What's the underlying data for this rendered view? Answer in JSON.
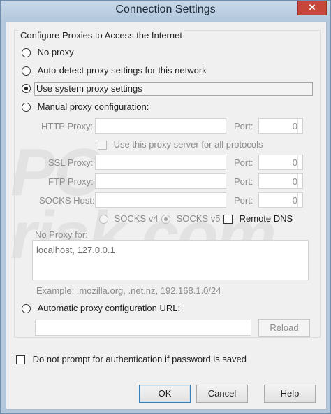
{
  "window": {
    "title": "Connection Settings",
    "close_label": "✕"
  },
  "group_label": "Configure Proxies to Access the Internet",
  "options": {
    "no_proxy": "No proxy",
    "auto_detect": "Auto-detect proxy settings for this network",
    "use_system": "Use system proxy settings",
    "manual": "Manual proxy configuration:",
    "auto_url": "Automatic proxy configuration URL:"
  },
  "manual": {
    "http_label": "HTTP Proxy:",
    "ssl_label": "SSL Proxy:",
    "ftp_label": "FTP Proxy:",
    "socks_label": "SOCKS Host:",
    "port_label": "Port:",
    "port_values": {
      "http": "0",
      "ssl": "0",
      "ftp": "0",
      "socks": "0"
    },
    "use_all_label": "Use this proxy server for all protocols",
    "socks_v4": "SOCKS v4",
    "socks_v5": "SOCKS v5",
    "remote_dns": "Remote DNS"
  },
  "no_proxy_for": {
    "label": "No Proxy for:",
    "value": "localhost, 127.0.0.1",
    "example": "Example: .mozilla.org, .net.nz, 192.168.1.0/24"
  },
  "auto_url": {
    "value": "",
    "reload_label": "Reload"
  },
  "auth_checkbox": "Do not prompt for authentication if password is saved",
  "buttons": {
    "ok": "OK",
    "cancel": "Cancel",
    "help": "Help"
  },
  "watermark": "PC risk.com"
}
